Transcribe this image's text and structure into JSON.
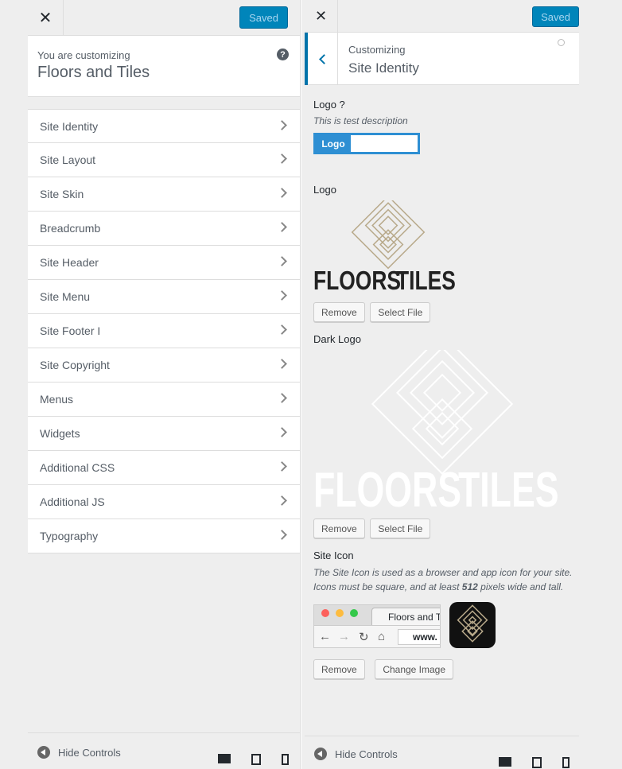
{
  "left": {
    "saved_label": "Saved",
    "info_small": "You are customizing",
    "info_title": "Floors and Tiles",
    "help_glyph": "?",
    "menu": [
      "Site Identity",
      "Site Layout",
      "Site Skin",
      "Breadcrumb",
      "Site Header",
      "Site Menu",
      "Site Footer I",
      "Site Copyright",
      "Menus",
      "Widgets",
      "Additional CSS",
      "Additional JS",
      "Typography"
    ],
    "hide_controls": "Hide Controls"
  },
  "right": {
    "saved_label": "Saved",
    "section_small": "Customizing",
    "section_title": "Site Identity",
    "logo_toggle": {
      "label": "Logo ?",
      "desc": "This is test description",
      "toggle_label": "Logo"
    },
    "logo": {
      "label": "Logo",
      "wordmark_left": "FLOORS",
      "wordmark_right": "TILES",
      "remove": "Remove",
      "select": "Select File"
    },
    "dark_logo": {
      "label": "Dark Logo",
      "remove": "Remove",
      "select": "Select File"
    },
    "site_icon": {
      "label": "Site Icon",
      "desc_1": "The Site Icon is used as a browser and app icon for your site.",
      "desc_2a": "Icons must be square, and at least ",
      "desc_2b": "512",
      "desc_2c": " pixels wide and tall.",
      "tab_title": "Floors and T",
      "url_text": "www.",
      "remove": "Remove",
      "change": "Change Image"
    },
    "hide_controls": "Hide Controls"
  },
  "colors": {
    "accent": "#0085ba",
    "toggle": "#2e8fd3",
    "logo_gold": "#b8a98a"
  }
}
